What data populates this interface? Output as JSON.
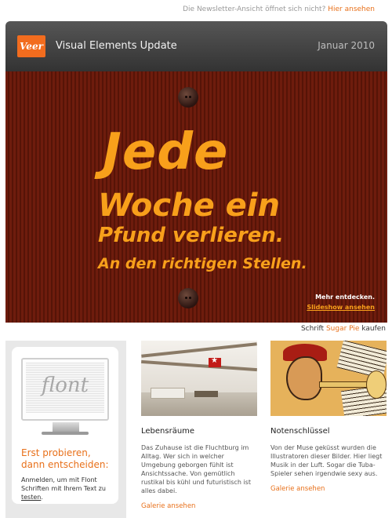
{
  "top_note": {
    "text": "Die Newsletter-Ansicht öffnet sich nicht?",
    "link": "Hier ansehen"
  },
  "header": {
    "logo_text": "Veer",
    "title": "Visual Elements Update",
    "date": "Januar 2010"
  },
  "hero": {
    "line1": "Jede",
    "line2": "Woche ein",
    "line3": "Pfund verlieren.",
    "line4": "An den richtigen Stellen.",
    "cta_text": "Mehr entdecken.",
    "cta_link": "Slideshow ansehen"
  },
  "font_credit": {
    "prefix": "Schrift",
    "font_name": "Sugar Pie",
    "suffix": "kaufen"
  },
  "promo": {
    "monitor_text": "flont",
    "heading": "Erst probieren, dann entscheiden:",
    "text": "Anmelden, um mit Flont Schriften mit Ihrem Text zu",
    "link": "testen",
    "text_end": "."
  },
  "articles": [
    {
      "title": "Lebensräume",
      "body": "Das Zuhause ist die Fluchtburg im Alltag. Wer sich in welcher Umgebung geborgen fühlt ist Ansichtssache. Von gemütlich rustikal bis kühl und futuristisch ist alles dabei.",
      "link": "Galerie ansehen"
    },
    {
      "title": "Notenschlüssel",
      "body": "Von der Muse geküsst wurden die Illustratoren dieser Bilder. Hier liegt Musik in der Luft. Sogar die Tuba-Spieler sehen irgendwie sexy aus.",
      "link": "Galerie ansehen"
    }
  ],
  "colors": {
    "accent": "#e8701a",
    "hero_bg": "#6b1a0c",
    "hero_text": "#f8a01b",
    "header_bg": "#444444"
  }
}
